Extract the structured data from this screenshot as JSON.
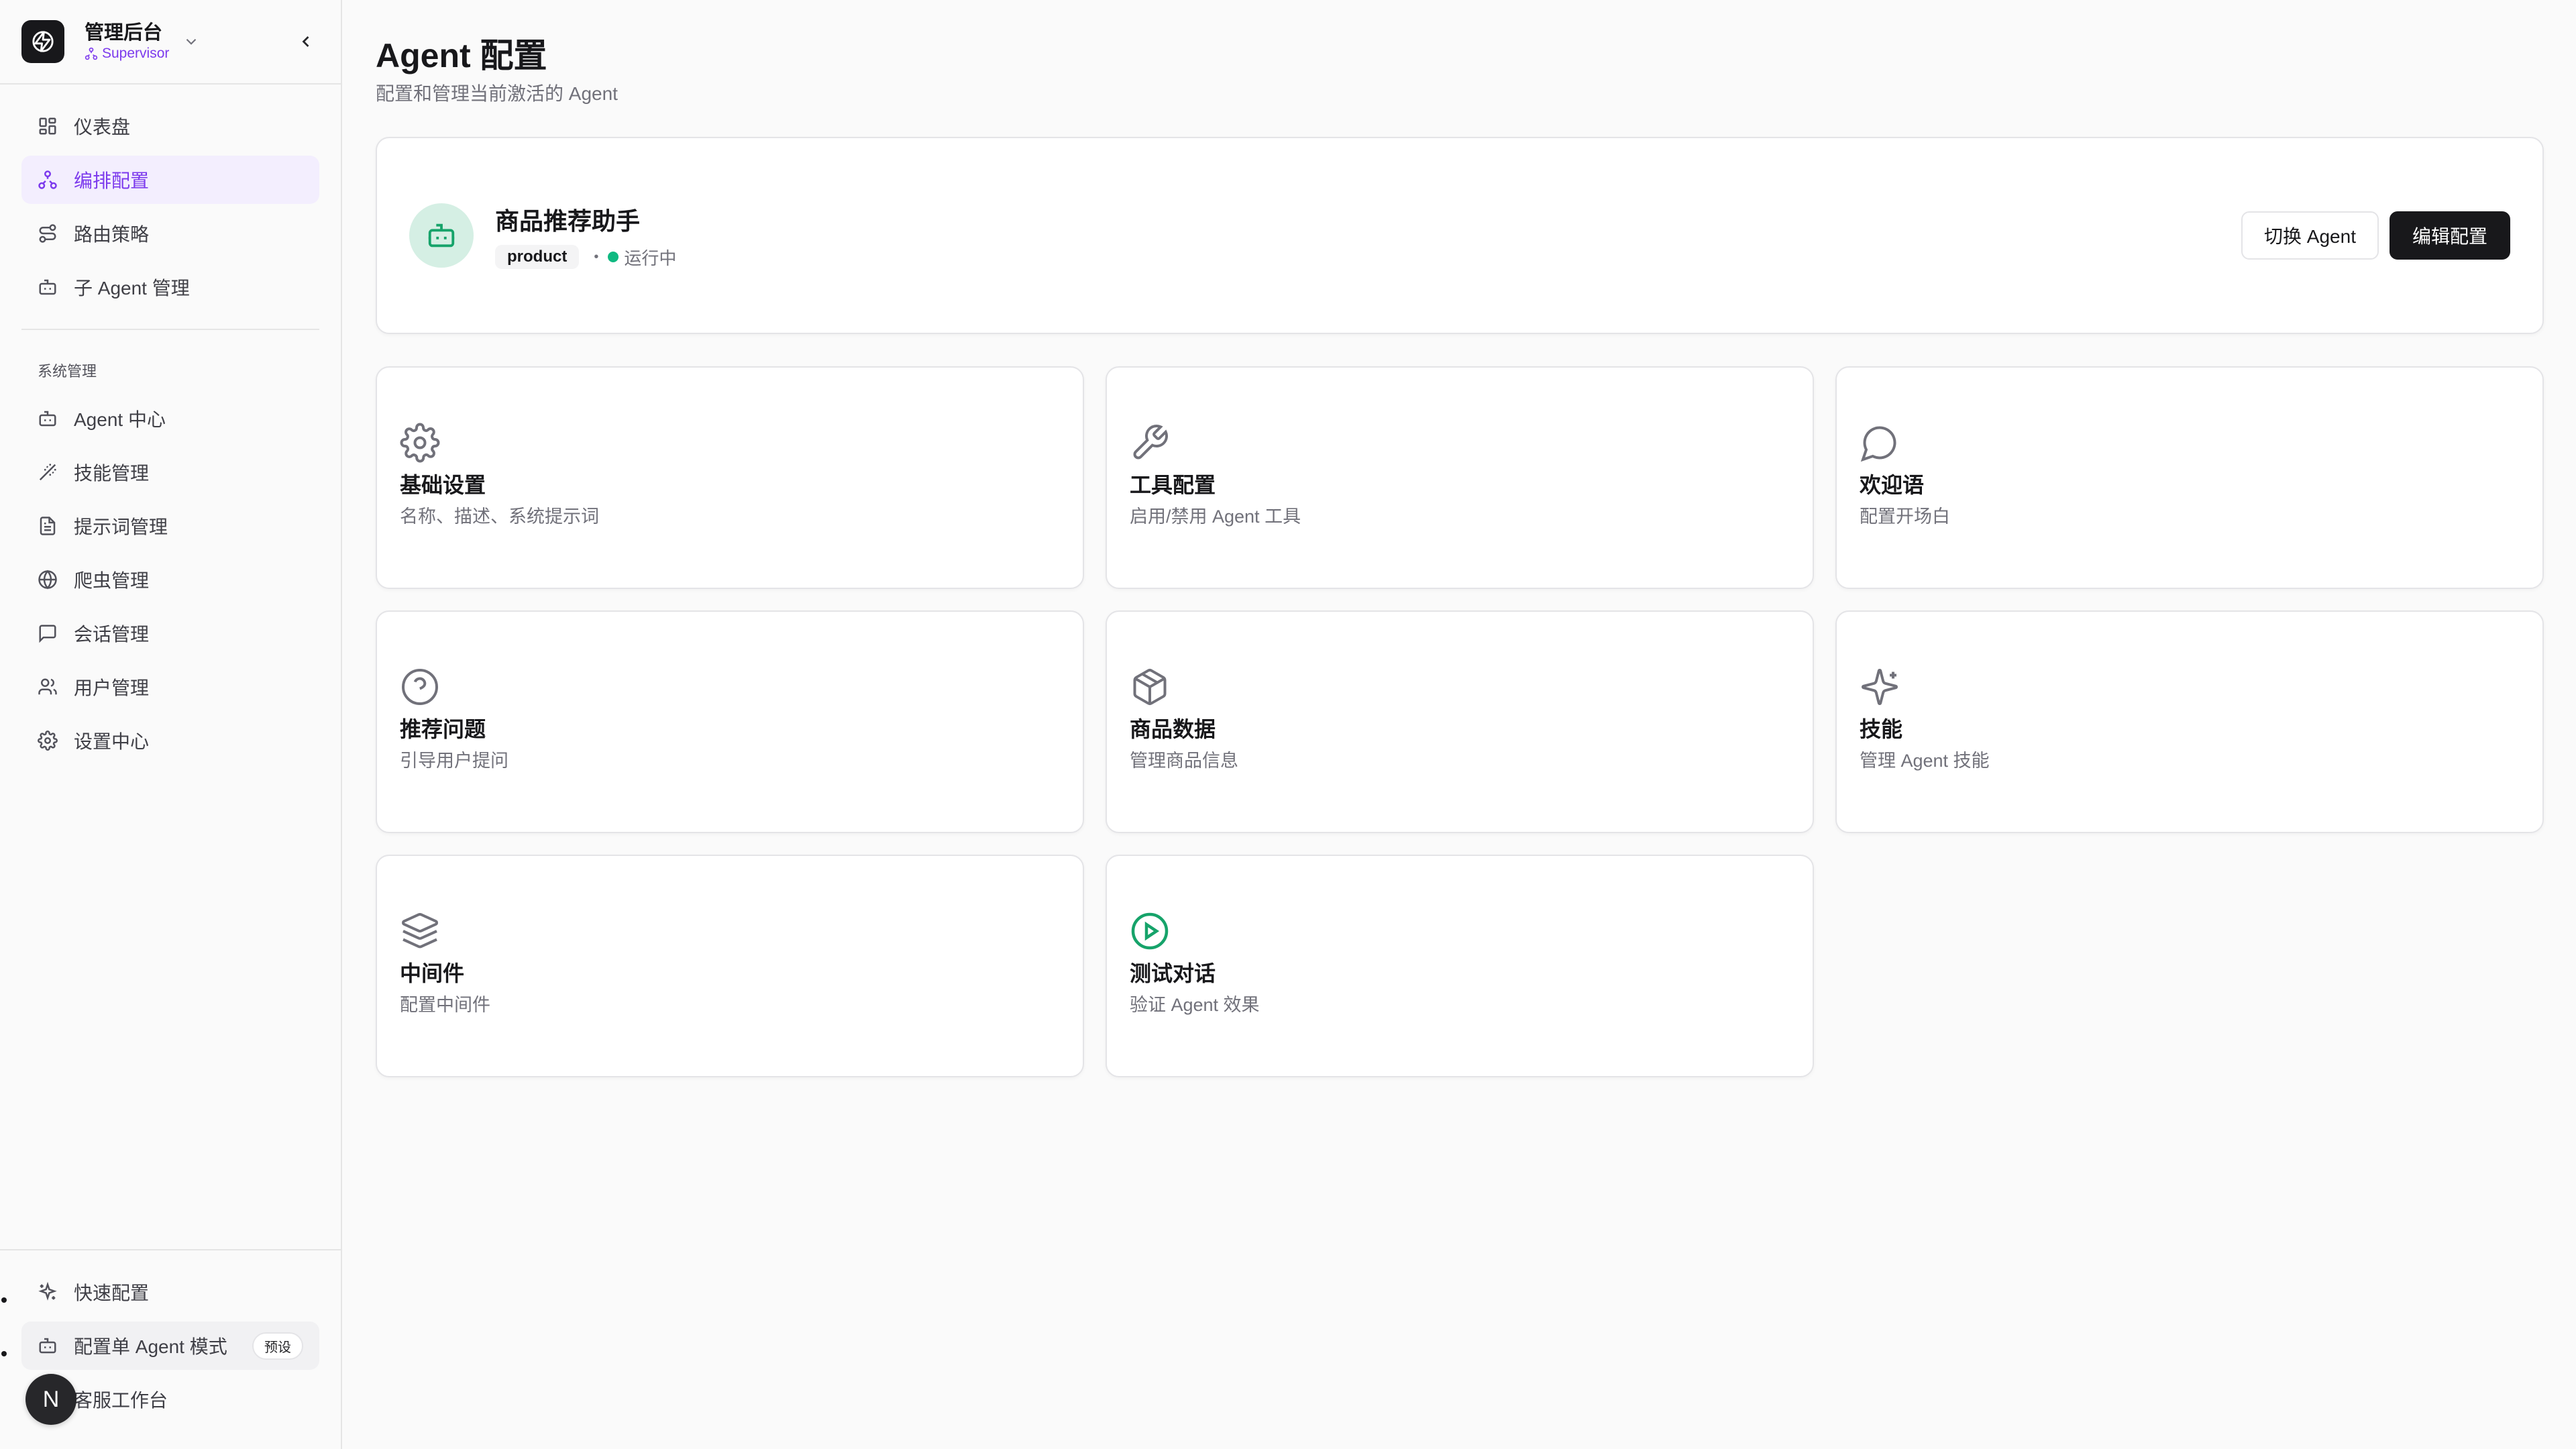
{
  "sidebar": {
    "brand_title": "管理后台",
    "brand_role": "Supervisor",
    "nav_items": [
      {
        "label": "仪表盘",
        "icon": "dashboard-icon"
      },
      {
        "label": "编排配置",
        "icon": "workflow-icon",
        "active": true
      },
      {
        "label": "路由策略",
        "icon": "route-icon"
      },
      {
        "label": "子 Agent 管理",
        "icon": "bot-icon"
      }
    ],
    "section_label": "系统管理",
    "system_items": [
      {
        "label": "Agent 中心",
        "icon": "bot-icon"
      },
      {
        "label": "技能管理",
        "icon": "wand-icon"
      },
      {
        "label": "提示词管理",
        "icon": "file-text-icon"
      },
      {
        "label": "爬虫管理",
        "icon": "globe-icon"
      },
      {
        "label": "会话管理",
        "icon": "message-square-icon"
      },
      {
        "label": "用户管理",
        "icon": "users-icon"
      },
      {
        "label": "设置中心",
        "icon": "settings-icon"
      }
    ],
    "footer_items": [
      {
        "label": "快速配置",
        "icon": "sparkles-icon"
      },
      {
        "label": "配置单 Agent 模式",
        "icon": "bot-icon",
        "badge": "预设"
      },
      {
        "label": "客服工作台",
        "icon": "headset-icon"
      }
    ],
    "avatar_letter": "N"
  },
  "header": {
    "title": "Agent 配置",
    "subtitle": "配置和管理当前激活的 Agent"
  },
  "agent": {
    "name": "商品推荐助手",
    "tag": "product",
    "status": "运行中",
    "switch_label": "切换 Agent",
    "edit_label": "编辑配置"
  },
  "cards": [
    {
      "title": "基础设置",
      "desc": "名称、描述、系统提示词",
      "icon": "settings-icon"
    },
    {
      "title": "工具配置",
      "desc": "启用/禁用 Agent 工具",
      "icon": "wrench-icon"
    },
    {
      "title": "欢迎语",
      "desc": "配置开场白",
      "icon": "message-circle-icon"
    },
    {
      "title": "推荐问题",
      "desc": "引导用户提问",
      "icon": "help-circle-icon"
    },
    {
      "title": "商品数据",
      "desc": "管理商品信息",
      "icon": "package-icon"
    },
    {
      "title": "技能",
      "desc": "管理 Agent 技能",
      "icon": "sparkles-icon"
    },
    {
      "title": "中间件",
      "desc": "配置中间件",
      "icon": "layers-icon"
    },
    {
      "title": "测试对话",
      "desc": "验证 Agent 效果",
      "icon": "play-circle-icon"
    }
  ],
  "colors": {
    "accent": "#7c3aed",
    "accent_bg": "#f3eefe",
    "status_green": "#10b981",
    "dark": "#18181b"
  }
}
